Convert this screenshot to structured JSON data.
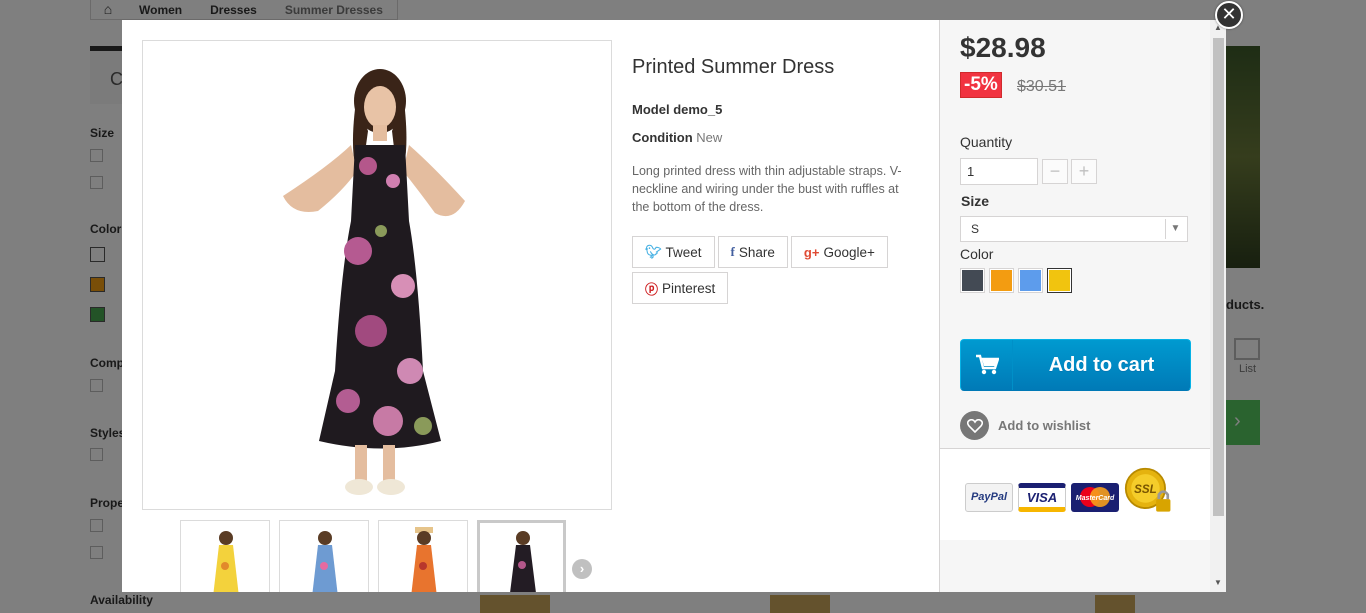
{
  "background": {
    "breadcrumb": [
      "Women",
      "Dresses",
      "Summer Dresses"
    ],
    "right_text": "ducts.",
    "list_label": "List"
  },
  "product": {
    "title": "Printed Summer Dress",
    "model_label": "Model",
    "model_value": "demo_5",
    "condition_label": "Condition",
    "condition_value": "New",
    "description": "Long printed dress with thin adjustable straps. V-neckline and wiring under the bust with ruffles at the bottom of the dress."
  },
  "social": {
    "tweet": "Tweet",
    "share": "Share",
    "googleplus": "Google+",
    "pinterest": "Pinterest"
  },
  "buy": {
    "price": "$28.98",
    "discount": "-5%",
    "old_price": "$30.51",
    "quantity_label": "Quantity",
    "quantity_value": "1",
    "size_label": "Size",
    "size_value": "S",
    "color_label": "Color",
    "colors": [
      "#434a54",
      "#f39c11",
      "#5d9cec",
      "#f1c40f"
    ],
    "selected_color_index": 3,
    "add_to_cart": "Add to cart",
    "add_to_wishlist": "Add to wishlist"
  },
  "payment": {
    "paypal": "PayPal",
    "visa": "VISA",
    "mastercard": "MasterCard",
    "ssl": "SSL"
  },
  "thumbnails": [
    {
      "name": "yellow dress"
    },
    {
      "name": "blue dress"
    },
    {
      "name": "orange dress"
    },
    {
      "name": "black floral dress"
    }
  ]
}
